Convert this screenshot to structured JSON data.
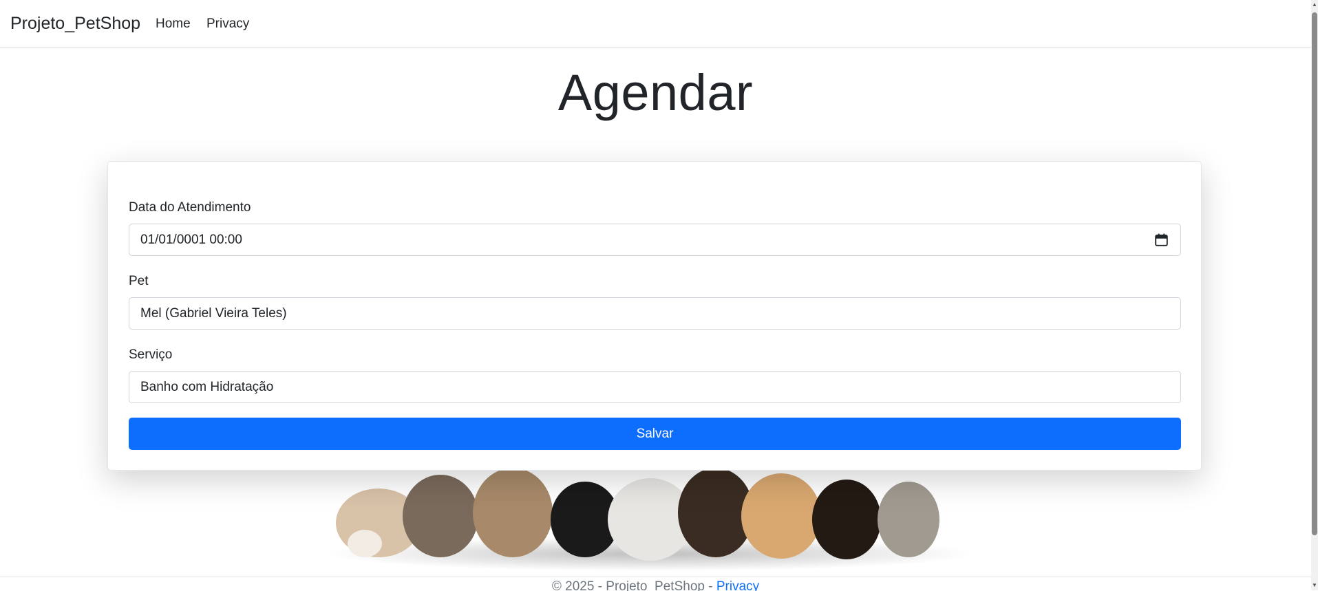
{
  "nav": {
    "brand": "Projeto_PetShop",
    "links": [
      "Home",
      "Privacy"
    ]
  },
  "page": {
    "title": "Agendar"
  },
  "form": {
    "date": {
      "label": "Data do Atendimento",
      "value": "01/01/0001 00:00"
    },
    "pet": {
      "label": "Pet",
      "value": "Mel (Gabriel Vieira Teles)"
    },
    "service": {
      "label": "Serviço",
      "value": "Banho com Hidratação"
    },
    "submit_label": "Salvar"
  },
  "footer": {
    "text": "© 2025 - Projeto_PetShop - ",
    "link": "Privacy"
  },
  "colors": {
    "primary": "#0d6efd",
    "text": "#212529",
    "muted": "#6c757d"
  },
  "icons": {
    "date_picker": "calendar-icon"
  }
}
